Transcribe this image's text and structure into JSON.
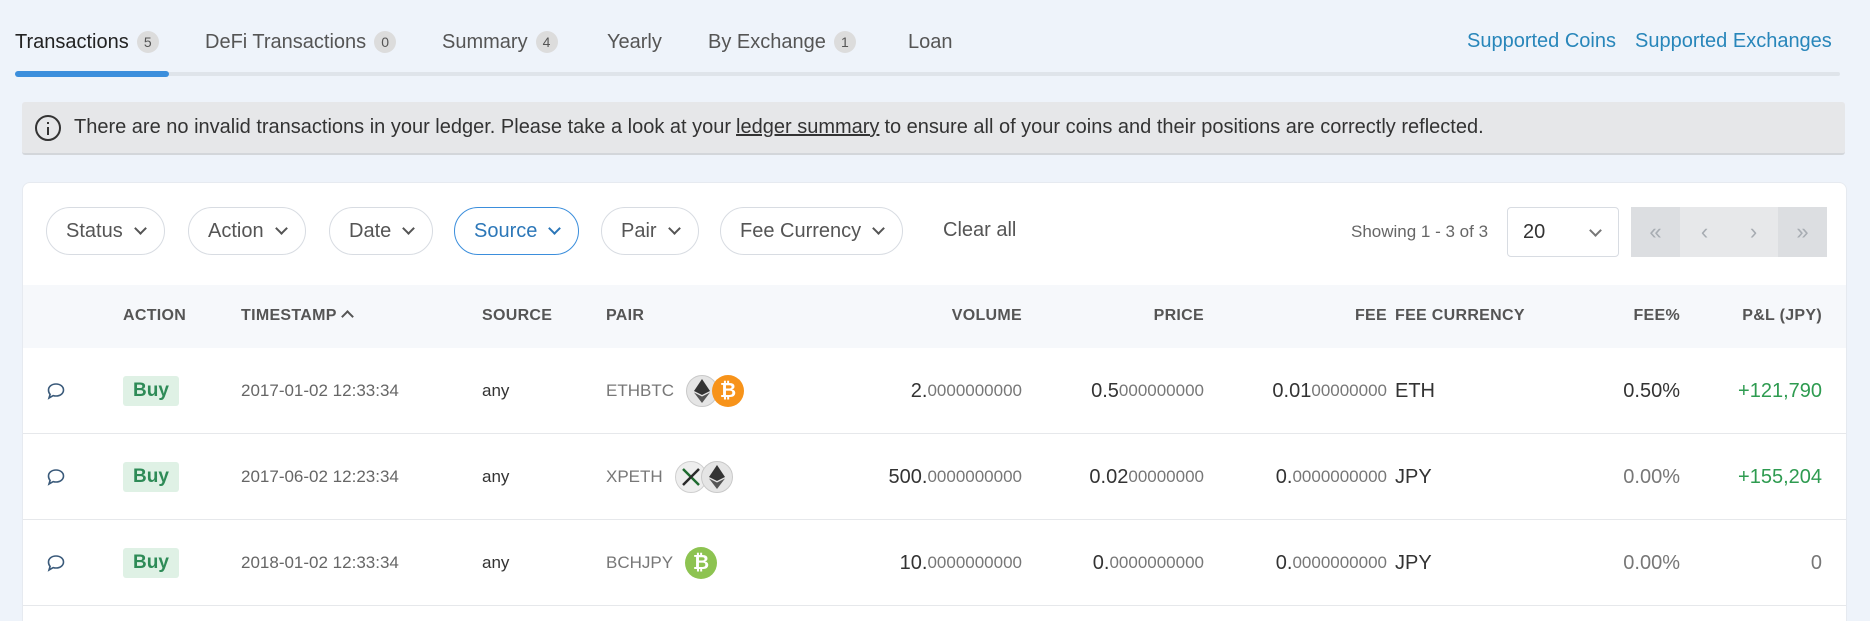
{
  "tabs": [
    {
      "label": "Transactions",
      "count": "5"
    },
    {
      "label": "DeFi Transactions",
      "count": "0"
    },
    {
      "label": "Summary",
      "count": "4"
    },
    {
      "label": "Yearly",
      "count": ""
    },
    {
      "label": "By Exchange",
      "count": "1"
    },
    {
      "label": "Loan",
      "count": ""
    }
  ],
  "top_links": {
    "supported_coins": "Supported Coins",
    "supported_exchanges": "Supported Exchanges"
  },
  "banner": {
    "text_before": "There are no invalid transactions in your ledger. Please take a look at your",
    "link": "ledger summary",
    "text_after": "to ensure all of your coins and their positions are correctly reflected."
  },
  "filters": {
    "status": "Status",
    "action": "Action",
    "date": "Date",
    "source": "Source",
    "pair": "Pair",
    "fee_currency": "Fee Currency",
    "clear_all": "Clear all"
  },
  "pagination": {
    "showing": "Showing 1 - 3 of 3",
    "page_size": "20"
  },
  "table": {
    "headers": {
      "action": "ACTION",
      "timestamp": "TIMESTAMP",
      "source": "SOURCE",
      "pair": "PAIR",
      "volume": "VOLUME",
      "price": "PRICE",
      "fee": "FEE",
      "fee_currency": "FEE CURRENCY",
      "fee_pct": "FEE%",
      "pnl": "P&L (JPY)"
    },
    "rows": [
      {
        "action": "Buy",
        "timestamp": "2017-01-02 12:33:34",
        "source": "any",
        "pair": "ETHBTC",
        "volume_int": "2.",
        "volume_dec": "0000000000",
        "price_int": "0.5",
        "price_dec": "000000000",
        "fee_int": "0.01",
        "fee_dec": "00000000",
        "fee_currency": "ETH",
        "fee_pct": "0.50%",
        "pnl": "+121,790",
        "icons": [
          "eth-icon",
          "btc-icon"
        ]
      },
      {
        "action": "Buy",
        "timestamp": "2017-06-02 12:23:34",
        "source": "any",
        "pair": "XPETH",
        "volume_int": "500.",
        "volume_dec": "0000000000",
        "price_int": "0.02",
        "price_dec": "00000000",
        "fee_int": "0.",
        "fee_dec": "0000000000",
        "fee_currency": "JPY",
        "fee_pct": "0.00%",
        "pnl": "+155,204",
        "icons": [
          "xp-icon",
          "eth-icon"
        ]
      },
      {
        "action": "Buy",
        "timestamp": "2018-01-02 12:33:34",
        "source": "any",
        "pair": "BCHJPY",
        "volume_int": "10.",
        "volume_dec": "0000000000",
        "price_int": "0.",
        "price_dec": "0000000000",
        "fee_int": "0.",
        "fee_dec": "0000000000",
        "fee_currency": "JPY",
        "fee_pct": "0.00%",
        "pnl": "0",
        "icons": [
          "bch-icon"
        ]
      }
    ]
  },
  "colors": {
    "accent": "#3b8edc",
    "link": "#2886ba",
    "positive": "#2e9b50",
    "buy_badge_bg": "#dff1e5"
  }
}
